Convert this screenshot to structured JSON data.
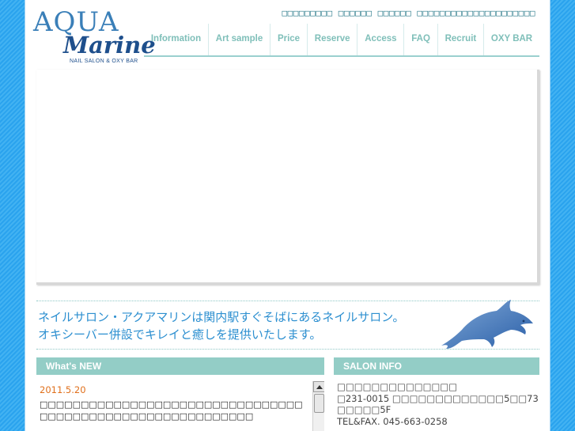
{
  "logo": {
    "aqua": "AQUA",
    "marine": "Marine",
    "sub": "NAIL SALON & OXY BAR"
  },
  "top_links": "□□□□□□□□□ □□□□□□ □□□□□□ □□□□□□□□□□□□□□□□□□□□□",
  "nav": {
    "items": [
      "Information",
      "Art sample",
      "Price",
      "Reserve",
      "Access",
      "FAQ",
      "Recruit",
      "OXY BAR"
    ]
  },
  "tagline": {
    "line1": "ネイルサロン・アクアマリンは関内駅すぐそばにあるネイルサロン。",
    "line2": "オキシーバー併設でキレイと癒しを提供いたします。"
  },
  "news": {
    "header": "What's NEW",
    "date": "2011.5.20",
    "text": "□□□□□□□□□□□□□□□□□□□□□□□□□□□□□□□□□□□□□□□□□□□□□□□□□□□□□□□□□□"
  },
  "salon_info": {
    "header": "SALON INFO",
    "lines": [
      "□□□□□□□□□□□□□□",
      "□231-0015 □□□□□□□□□□□□□5□□73",
      "□□□□□5F",
      "TEL&FAX. 045-663-0258"
    ]
  },
  "colors": {
    "background": "#2aa3ee",
    "nav_text": "#7fbfb9",
    "section_header": "#93cdc6",
    "tagline": "#2c8fd0",
    "news_date": "#e0701c",
    "logo_dark": "#1e4f8c"
  },
  "icons": {
    "dolphin": "dolphin-icon",
    "scroll_up": "scroll-up-arrow-icon"
  }
}
